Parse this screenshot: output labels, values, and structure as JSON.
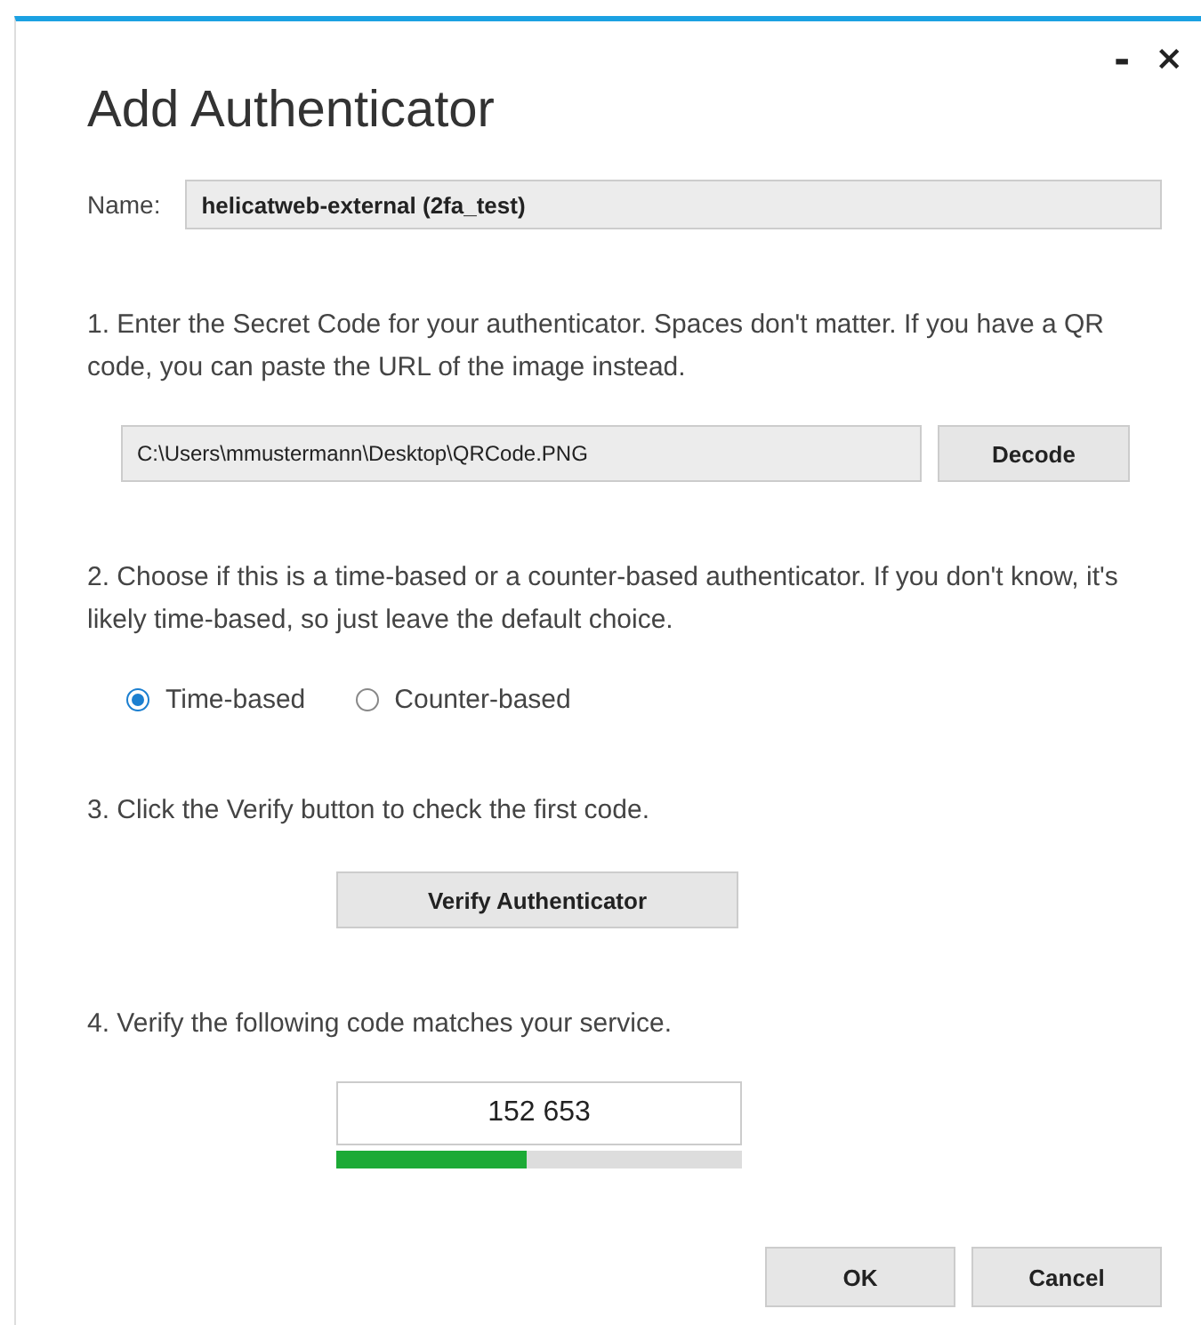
{
  "window": {
    "title": "Add Authenticator",
    "controls": [
      {
        "kind": "minimize",
        "label": "-"
      },
      {
        "kind": "close",
        "label": "×"
      }
    ]
  },
  "name_field": {
    "label": "Name:",
    "value": "helicatweb-external (2fa_test)"
  },
  "step1": {
    "text": "1. Enter the Secret Code for your authenticator. Spaces don't matter. If you have a QR code, you can paste the URL of the image instead.",
    "secret_field": {
      "value": "C:\\Users\\mmustermann\\Desktop\\QRCode.PNG"
    },
    "button": "Decode"
  },
  "step2": {
    "text": "2. Choose if this is a time-based or a counter-based authenticator. If you don't know, it's likely time-based, so just leave the default choice.",
    "options": [
      {
        "label": "Time-based",
        "selected": true
      },
      {
        "label": "Counter-based",
        "selected": false
      }
    ]
  },
  "step3": {
    "text": "3. Click the Verify button to check the first code.",
    "button": "Verify Authenticator"
  },
  "step4": {
    "text": "4. Verify the following code matches your service.",
    "code": "152 653",
    "level": 0.47
  },
  "buttons": [
    "OK",
    "Cancel"
  ]
}
